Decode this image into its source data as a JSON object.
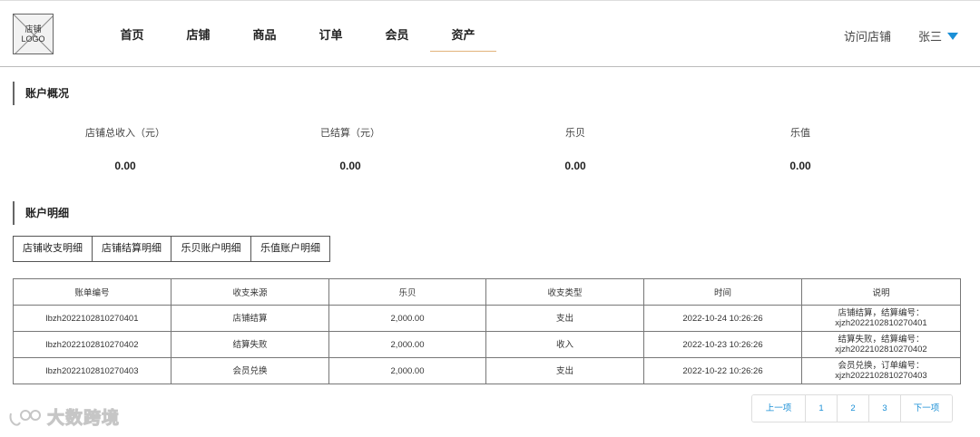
{
  "header": {
    "logo_text": "店铺\nLOGO",
    "nav": [
      "首页",
      "店铺",
      "商品",
      "订单",
      "会员",
      "资产"
    ],
    "active_index": 5,
    "visit_store": "访问店铺",
    "user_name": "张三",
    "accent_color": "#1a8fd6",
    "active_underline_color": "#e2b37a"
  },
  "overview": {
    "title": "账户概况",
    "items": [
      {
        "label": "店铺总收入（元）",
        "value": "0.00"
      },
      {
        "label": "已结算（元）",
        "value": "0.00"
      },
      {
        "label": "乐贝",
        "value": "0.00"
      },
      {
        "label": "乐值",
        "value": "0.00"
      }
    ]
  },
  "details": {
    "title": "账户明细",
    "tabs": [
      "店铺收支明细",
      "店铺结算明细",
      "乐贝账户明细",
      "乐值账户明细"
    ],
    "table": {
      "columns": [
        "账单编号",
        "收支来源",
        "乐贝",
        "收支类型",
        "时间",
        "说明"
      ],
      "rows": [
        [
          "lbzh2022102810270401",
          "店铺结算",
          "2,000.00",
          "支出",
          "2022-10-24 10:26:26",
          "店铺结算，结算编号：\nxjzh2022102810270401"
        ],
        [
          "lbzh2022102810270402",
          "结算失败",
          "2,000.00",
          "收入",
          "2022-10-23 10:26:26",
          "结算失败，结算编号：\nxjzh2022102810270402"
        ],
        [
          "lbzh2022102810270403",
          "会员兑换",
          "2,000.00",
          "支出",
          "2022-10-22 10:26:26",
          "会员兑换，订单编号：\nxjzh2022102810270403"
        ]
      ]
    }
  },
  "pagination": {
    "prev": "上一项",
    "pages": [
      "1",
      "2",
      "3"
    ],
    "next": "下一项"
  },
  "watermark": {
    "text": "大数跨境"
  }
}
